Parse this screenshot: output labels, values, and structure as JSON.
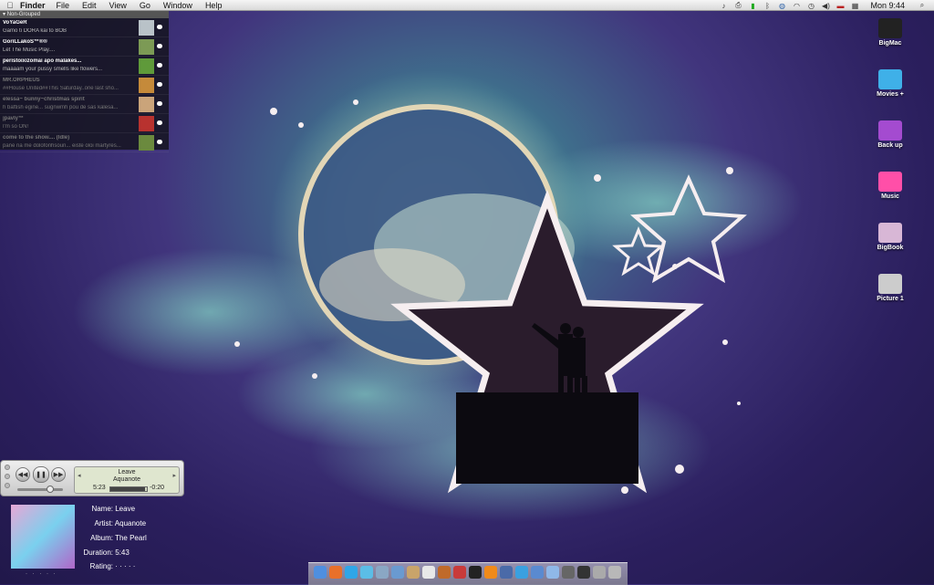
{
  "menubar": {
    "apple_icon": "apple-icon",
    "app_name": "Finder",
    "menus": [
      "File",
      "Edit",
      "View",
      "Go",
      "Window",
      "Help"
    ],
    "clock": "Mon 9:44",
    "status_icons": [
      "music-icon",
      "printer-icon",
      "battery-icon",
      "bluetooth-icon",
      "globe-icon",
      "wifi-icon",
      "time-machine-icon",
      "volume-icon",
      "flag-icon",
      "spaces-icon",
      "spotlight-icon"
    ]
  },
  "buddy_list": {
    "group": "Non-Grouped",
    "buddies": [
      {
        "name": "VoYaGeR",
        "status": "Gamo ti DORA kai to BOB",
        "avatar": "#b9c2c8",
        "idle": false
      },
      {
        "name": "GoriLLakoS™®®",
        "status": "Let The Music Play....",
        "avatar": "#7c9a55",
        "idle": false
      },
      {
        "name": "peristoixizomai apo malakes...",
        "status": "maaaam your pussy smells like flowers...",
        "avatar": "#5f9a3a",
        "idle": false
      },
      {
        "name": "MR.ORPHEUS",
        "status": "##House United##This Saturday..one last sho...",
        "avatar": "#c58a3a",
        "idle": true
      },
      {
        "name": "elessa~ bunny~christmas spirit",
        "status": "h baftish egine... sugnwmh pou de sas kalesa...",
        "avatar": "#caa47a",
        "idle": true
      },
      {
        "name": "jpavly™",
        "status": "I'm so ON!",
        "avatar": "#b8322f",
        "idle": true
      },
      {
        "name": "come to the show.... (Idle)",
        "status": "pane na me dolofonhsoun... eiste oloi martyres...",
        "avatar": "#6b8a3e",
        "idle": true
      }
    ]
  },
  "desktop_icons": [
    {
      "label": "BigMac",
      "color": "#222222"
    },
    {
      "label": "Movies +",
      "color": "#3fb0e8"
    },
    {
      "label": "Back up",
      "color": "#a44bd0"
    },
    {
      "label": "Music",
      "color": "#ff4fa8"
    },
    {
      "label": "BigBook",
      "color": "#d8b7d6"
    },
    {
      "label": "Picture 1",
      "color": "#cccccc"
    }
  ],
  "player": {
    "prev_label": "◀◀",
    "pause_label": "❚❚",
    "next_label": "▶▶",
    "song": "Leave",
    "artist": "Aquanote",
    "elapsed": "5:23",
    "remaining": "-0:20",
    "progress": 0.94,
    "volume": 0.72
  },
  "now_playing": {
    "name_label": "Name:",
    "name": "Leave",
    "artist_label": "Artist:",
    "artist": "Aquanote",
    "album_label": "Album:",
    "album": "The Pearl",
    "duration_label": "Duration:",
    "duration": "5:43",
    "rating_label": "Rating:",
    "rating": "· · · · ·",
    "art_dots": "· · · · ·"
  },
  "dock_items": [
    {
      "icon": "finder-icon",
      "color": "#4f8fe0"
    },
    {
      "icon": "firefox-icon",
      "color": "#e8702a"
    },
    {
      "icon": "skype-icon",
      "color": "#2fa6e8"
    },
    {
      "icon": "safari-icon",
      "color": "#5bbde6"
    },
    {
      "icon": "preview-icon",
      "color": "#8aa7c4"
    },
    {
      "icon": "iphoto-icon",
      "color": "#6a9ad0"
    },
    {
      "icon": "address-book-icon",
      "color": "#c9a46a"
    },
    {
      "icon": "ical-icon",
      "color": "#e8e8e8"
    },
    {
      "icon": "guitar-icon",
      "color": "#c06a2a"
    },
    {
      "icon": "itunes-icon",
      "color": "#c83a3a"
    },
    {
      "icon": "steam-icon",
      "color": "#222222"
    },
    {
      "icon": "vlc-icon",
      "color": "#f08a1a"
    },
    {
      "icon": "xcode-icon",
      "color": "#4a6aa8"
    },
    {
      "icon": "network-icon",
      "color": "#3aa0e0"
    },
    {
      "icon": "activity-icon",
      "color": "#5a8ad0"
    },
    {
      "icon": "folder-icon",
      "color": "#8fb8e8"
    },
    {
      "icon": "camera-icon",
      "color": "#666666"
    },
    {
      "icon": "terminal-icon",
      "color": "#333333"
    },
    {
      "icon": "screen-icon",
      "color": "#aaaaaa"
    },
    {
      "icon": "trash-icon",
      "color": "#b8b8b8"
    }
  ]
}
